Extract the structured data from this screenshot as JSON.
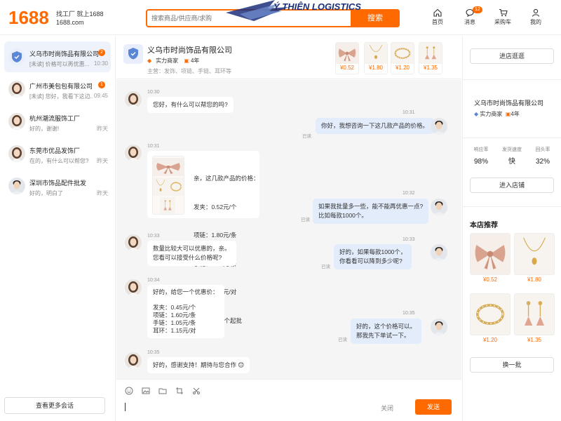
{
  "header": {
    "logo": "1688",
    "logo_sub1": "找工厂  就上1688",
    "logo_sub2": "1688.com",
    "search_placeholder": "搜索商品/供应商/求购",
    "search_button": "搜索",
    "watermark": "Ý THIÊN LOGISTICS",
    "nav": [
      {
        "label": "首页",
        "icon": "home-icon"
      },
      {
        "label": "消息",
        "icon": "message-icon",
        "badge": "12"
      },
      {
        "label": "采购车",
        "icon": "cart-icon"
      },
      {
        "label": "我的",
        "icon": "user-icon"
      }
    ]
  },
  "conversations": [
    {
      "name": "义乌市时尚饰品有限公司",
      "msg": "[未读] 价格可以再优惠...",
      "time": "10:30",
      "badge": "2",
      "active": true
    },
    {
      "name": "广州市美包包有限公司",
      "msg": "[未读] 您好，我看下这边...",
      "time": "09:45",
      "badge": "1"
    },
    {
      "name": "杭州潮流服饰工厂",
      "msg": "好的，谢谢!",
      "time": "昨天"
    },
    {
      "name": "东莞市优品发饰厂",
      "msg": "在的，有什么可以帮您?",
      "time": "昨天"
    },
    {
      "name": "深圳市饰品配件批发",
      "msg": "好的，明白了",
      "time": "昨天"
    }
  ],
  "more_conversations": "查看更多会话",
  "shop": {
    "name": "义乌市时尚饰品有限公司",
    "tag": "实力商家",
    "years": "4年",
    "main": "主营：发饰、项链、手链、耳环等",
    "products": [
      {
        "price": "¥0.52",
        "img": "bow"
      },
      {
        "price": "¥1.80",
        "img": "necklace"
      },
      {
        "price": "¥1.20",
        "img": "bracelet"
      },
      {
        "price": "¥1.35",
        "img": "earring"
      }
    ]
  },
  "messages": {
    "m1_time": "10:30",
    "m1": "您好，有什么可以帮您的吗?",
    "m2_time": "10:31",
    "m2": "你好，我想咨询一下这几款产品的价格。",
    "m2_read": "已读",
    "m3_time": "10:31",
    "m3_lines": [
      "亲，这几款产品的价格：",
      "发夹：0.52元/个",
      "项链：1.80元/条",
      "手链：1.20元/条",
      "耳环：1.35元/对",
      "起订量：50个起批"
    ],
    "m4_time": "10:32",
    "m4": "如果我批量多一些，能不能再优惠一点?\n比如每款1000个。",
    "m4_read": "已读",
    "m5_time": "10:33",
    "m5": "数量比较大可以优惠的，亲。\n您看可以接受什么价格呢?",
    "m6_time": "10:33",
    "m6": "好的，如果每款1000个，\n你看看可以降到多少呢?",
    "m6_read": "已读",
    "m7_time": "10:34",
    "m7": "好的，给您一个优惠价：\n\n发夹：0.45元/个\n项链：1.60元/条\n手链：1.05元/条\n耳环：1.15元/对",
    "m8_time": "10:35",
    "m8": "好的，这个价格可以。\n那我先下单试一下。",
    "m8_read": "已读",
    "m9_time": "10:35",
    "m9": "好的，感谢支持！期待与您合作 😊"
  },
  "input": {
    "close": "关闭",
    "send": "发送"
  },
  "right": {
    "visit_shop": "进店逛逛",
    "name": "义乌市时尚饰品有限公司",
    "tag": "实力商家",
    "years": "4年",
    "stats": [
      {
        "label": "响应率",
        "value": "98%"
      },
      {
        "label": "发货速度",
        "value": "快"
      },
      {
        "label": "回头率",
        "value": "32%"
      }
    ],
    "enter_shop": "进入店铺",
    "rec_title": "本店推荐",
    "rec": [
      {
        "price": "¥0.52",
        "img": "bow"
      },
      {
        "price": "¥1.80",
        "img": "necklace"
      },
      {
        "price": "¥1.20",
        "img": "bracelet"
      },
      {
        "price": "¥1.35",
        "img": "earring"
      }
    ],
    "refresh": "换一批"
  },
  "colors": {
    "accent": "#ff6a00",
    "bubble_me": "#e3ecfb",
    "chat_bg": "#f5f5f5"
  }
}
